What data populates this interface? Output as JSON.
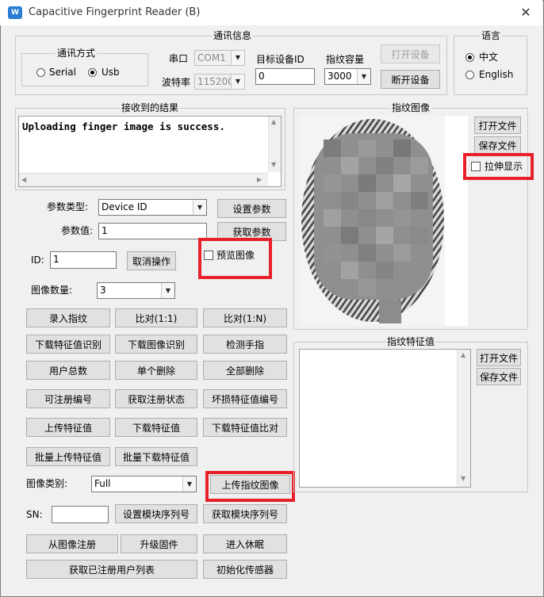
{
  "window": {
    "title": "Capacitive Fingerprint Reader (B)",
    "icon": "app-logo-icon",
    "close_glyph": "✕"
  },
  "comm_info": {
    "title": "通讯信息",
    "mode_group": {
      "title": "通讯方式",
      "serial": "Serial",
      "usb": "Usb",
      "selected": "Usb"
    },
    "port_label": "串口",
    "port_value": "COM1",
    "baud_label": "波特率",
    "baud_value": "115200",
    "target_id_label": "目标设备ID",
    "target_id_value": "0",
    "capacity_label": "指纹容量",
    "capacity_value": "3000",
    "open_device": "打开设备",
    "close_device": "断开设备"
  },
  "language": {
    "title": "语言",
    "chinese": "中文",
    "english": "English",
    "selected": "中文"
  },
  "received": {
    "title": "接收到的结果",
    "text": "Uploading finger image is success."
  },
  "params": {
    "type_label": "参数类型",
    "type_value": "Device ID",
    "value_label": "参数值",
    "value_value": "1",
    "set_params": "设置参数",
    "get_params": "获取参数"
  },
  "id_row": {
    "label": "ID",
    "value": "1",
    "cancel": "取消操作",
    "preview_label": "预览图像"
  },
  "image_count": {
    "label": "图像数量",
    "value": "3"
  },
  "buttons": {
    "enroll": "录入指纹",
    "match_11": "比对(1:1)",
    "match_1n": "比对(1:N)",
    "download_feature_identify": "下载特征值识别",
    "download_image_identify": "下载图像识别",
    "detect_finger": "检测手指",
    "user_total": "用户总数",
    "single_delete": "单个删除",
    "delete_all": "全部删除",
    "registerable_id": "可注册编号",
    "get_reg_status": "获取注册状态",
    "damaged_feature_id": "坏损特征值编号",
    "upload_feature": "上传特征值",
    "download_feature": "下载特征值",
    "download_feature_compare": "下载特征值比对",
    "batch_upload_feature": "批量上传特征值",
    "batch_download_feature": "批量下载特征值",
    "upload_fingerprint_image": "上传指纹图像",
    "set_module_sn": "设置模块序列号",
    "get_module_sn": "获取模块序列号",
    "register_from_image": "从图像注册",
    "upgrade_firmware": "升级固件",
    "enter_sleep": "进入休眠",
    "get_registered_users": "获取已注册用户列表",
    "init_sensor": "初始化传感器"
  },
  "image_type": {
    "label": "图像类别",
    "value": "Full"
  },
  "sn": {
    "label": "SN",
    "value": ""
  },
  "fingerprint_image": {
    "title": "指纹图像",
    "open_file": "打开文件",
    "save_file": "保存文件",
    "stretch_label": "拉伸显示"
  },
  "feature_value": {
    "title": "指纹特征值",
    "open_file": "打开文件",
    "save_file": "保存文件"
  },
  "colors": {
    "highlight": "#e8202a",
    "window_bg": "#f0f0f0",
    "button_bg": "#e1e1e1"
  }
}
